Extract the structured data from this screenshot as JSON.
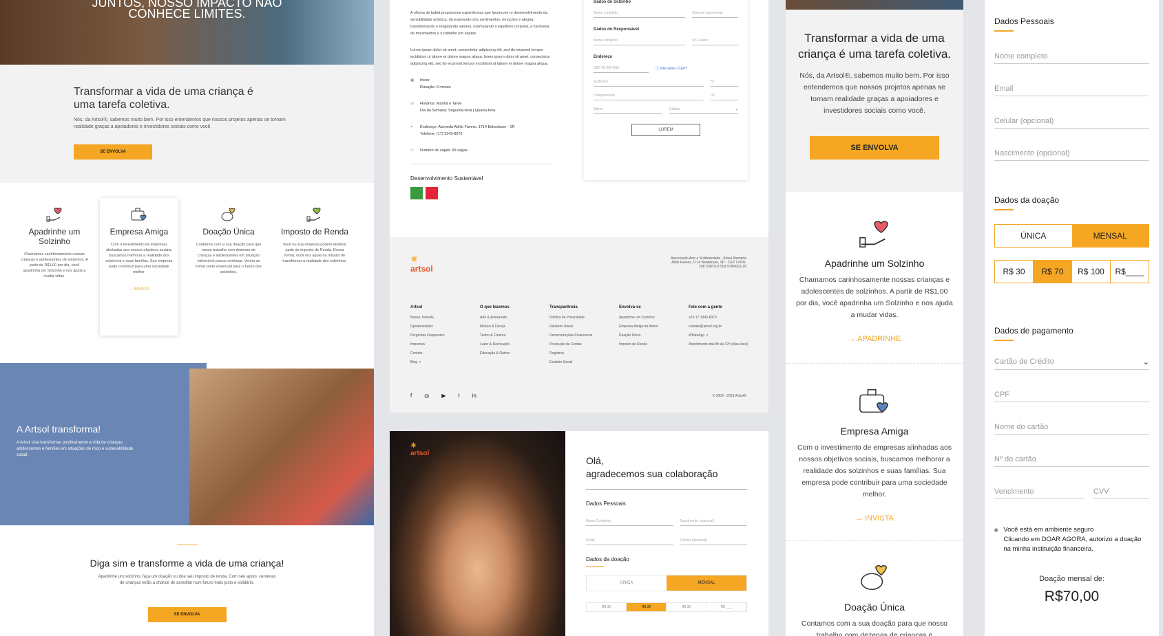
{
  "colA": {
    "hero_line1": "JUNTOS, NOSSO IMPACTO NÃO",
    "hero_line2": "CONHECE LIMITES.",
    "intro_title": "Transformar a vida de uma criança é uma tarefa coletiva.",
    "intro_text": "Nós, da Artsol®, sabemos muito bem. Por isso entendemos que nossos projetos apenas se tornam realidade graças a apoiadores e investidores sociais como você.",
    "intro_button": "SE ENVOLVA",
    "cards": [
      {
        "title": "Apadrinhe um Solzinho",
        "text": "Chamamos carinhosamente nossas crianças e adolescentes de solzinhos. A partir de R$1,00 por dia, você apadrinha um Solzinho e nos ajuda a mudar vidas."
      },
      {
        "title": "Empresa Amiga",
        "text": "Com o investimento de empresas alinhadas aos nossos objetivos sociais, buscamos melhorar a realidade dos solzinhos e suas famílias. Sua empresa pode contribuir para uma sociedade melhor.",
        "link": "INVISTA"
      },
      {
        "title": "Doação Única",
        "text": "Contamos com a sua doação para que nosso trabalho com dezenas de crianças e adolescentes em situação vulnerável possa continuar. Venha se tornar parte essencial para o futuro dos solzinhos."
      },
      {
        "title": "Imposto de Renda",
        "text": "Você ou sua empresa podem destinar parte do imposto de Renda. Dessa forma, você nos apoia na missão de transformar a realidade dos solzinhos."
      }
    ],
    "transform_title": "A Artsol transforma!",
    "transform_text": "A Artsol visa transformar positivamente a vida de crianças, adolescentes e famílias em situações de risco e vulnerabilidade social.",
    "cta_title": "Diga sim e transforme a vida de uma criança!",
    "cta_text": "Apadrinhe um solzinho, faça um doação ou doe seu imposto de renda. Com seu apoio, centenas de crianças terão a chance de acreditar num futuro mais justo e solidário.",
    "cta_button": "SE ENVOLVA"
  },
  "colB": {
    "desc1": "A oficina de ballet proporciona experiências que favorecem o desenvolvimento da sensibilidade artística, da expressão dos sentimentos, emoções e alegria, transformando e resgatando valores, estimulando o equilíbrio corporal, a harmonia de movimentos e o trabalho em equipe.",
    "desc2": "Lorem ipsum dolor sit amet, consectetur adipiscing elit, sed do eiusmod tempor incididunt ut labore et dolore magna aliqua. lorem ipsum dolor sit amet, consectetur adipiscing elit, sed do eiusmod tempor incididunt ut labore et dolore magna aliqua.",
    "inicio_label": "Início:",
    "inicio_value": "Duração: 6 meses",
    "horarios": "Horários: Manhã e Tarde",
    "dias": "Dia da Semana: Segunda-feira | Quarta-feira",
    "endereco": "Endereço: Alameda Attílio Favero, 1714 Bebedouro - SP.",
    "telefone": "Telefone: (17) 3343-8070",
    "vagas": "Numero de vagas: 99 vagas",
    "ods_title": "Desenvolvimento Sustentável",
    "form": {
      "solzinho_title": "Dados do Solzinho",
      "nome": "Nome completo",
      "nascimento": "Data de nascimento",
      "responsavel_title": "Dados do Responsável",
      "nome_resp": "Nome completo",
      "celular": "Nº Celular",
      "endereco_title": "Endereço",
      "cep": "CEP 00.000-000",
      "nao_sabe": "Não sabe o CEP?",
      "endereco": "Endereço",
      "numero": "Nº",
      "complemento": "Complemento",
      "uf": "UF",
      "bairro": "Bairro",
      "cidade": "Cidade",
      "button": "LOREM"
    },
    "footer": {
      "logo": "artsol",
      "address": "Associação Arte e Solidariedade - Artsol Alameda Atílio Favero, 1714 Bebedouro, SP - CEP 14706-258 CNPJ 07.992.978/0001-26",
      "columns": [
        {
          "title": "Artsol",
          "items": [
            "Nossa Jornada",
            "Oportunidades",
            "Perguntas Frequentes",
            "Imprensa",
            "Contato",
            "Blog ↗"
          ]
        },
        {
          "title": "O que fazemos",
          "items": [
            "Arte & Artesanato",
            "Música & Dança",
            "Teatro & Cinema",
            "Lazer & Recreação",
            "Educação & Outros"
          ]
        },
        {
          "title": "Transparência",
          "items": [
            "Política de Privacidade",
            "Relatório Anual",
            "Demonstrações Financeiras",
            "Prestação de Contas",
            "Registros",
            "Estatuto Social"
          ]
        },
        {
          "title": "Envolva-se",
          "items": [
            "Apadrinhe um Solzinho",
            "Empresa Amiga da Artsol",
            "Doação Única",
            "Imposto de Renda"
          ]
        },
        {
          "title": "Fale com a gente",
          "items": [
            "+55 17 3343-8070",
            "contato@artsol.org.br",
            "WhatsApp ↗",
            "Atendimento das 8h às 17h (dias úteis)"
          ]
        }
      ],
      "social": [
        "f",
        "◎",
        "▶",
        "t",
        "in"
      ],
      "copyright": "© 2003 - 2023 Artsol®"
    }
  },
  "colC": {
    "logo": "artsol",
    "greeting1": "Olá,",
    "greeting2": "agradecemos sua colaboração",
    "pessoais_title": "Dados Pessoais",
    "nome": "Nome Completo",
    "nascimento": "Nascimento (opcional)",
    "email": "Email",
    "celular": "Celular (opcional)",
    "doacao_title": "Dados da doação",
    "unica": "ÚNICA",
    "mensal": "MENSAL",
    "amounts": [
      "R$ 30",
      "R$ 30",
      "R$ 30",
      "R$ ___"
    ]
  },
  "colD": {
    "title": "Transformar a vida de uma criança é uma tarefa coletiva.",
    "text": "Nós, da Artsol®, sabemos muito bem. Por isso entendemos que nossos projetos apenas se tornam realidade graças a apoiadores e investidores sociais como você.",
    "button": "SE ENVOLVA",
    "cards": [
      {
        "title": "Apadrinhe um Solzinho",
        "text": "Chamamos carinhosamente nossas crianças e adolescentes de solzinhos. A partir de R$1,00 por dia, você apadrinha um Solzinho e nos ajuda a mudar vidas.",
        "link": "APADRINHE"
      },
      {
        "title": "Empresa Amiga",
        "text": "Com o investimento de empresas alinhadas aos nossos objetivos sociais, buscamos melhorar a realidade dos solzinhos e suas famílias. Sua empresa pode contribuir para uma sociedade melhor.",
        "link": "INVISTA"
      },
      {
        "title": "Doação Única",
        "text": "Contamos com a sua doação para que nosso trabalho com dezenas de crianças e"
      }
    ]
  },
  "colE": {
    "pessoais_title": "Dados Pessoais",
    "nome": "Nome completo",
    "email": "Email",
    "celular": "Celular (opcional)",
    "nascimento": "Nascimento (opcional)",
    "doacao_title": "Dados da doação",
    "unica": "ÚNICA",
    "mensal": "MENSAL",
    "amounts": [
      "R$ 30",
      "R$ 70",
      "R$ 100",
      "R$____"
    ],
    "pagamento_title": "Dados de pagamento",
    "cartao": "Cartão de Crédito",
    "cpf": "CPF",
    "nome_cartao": "Nome do cartão",
    "num_cartao": "Nº do cartão",
    "vencimento": "Vencimento",
    "cvv": "CVV",
    "secure1": "Você está em ambiente seguro",
    "secure2": "Clicando em DOAR AGORA, autorizo a doação na minha instituição financeira.",
    "total_label": "Doação mensal de:",
    "total_value": "R$70,00"
  }
}
